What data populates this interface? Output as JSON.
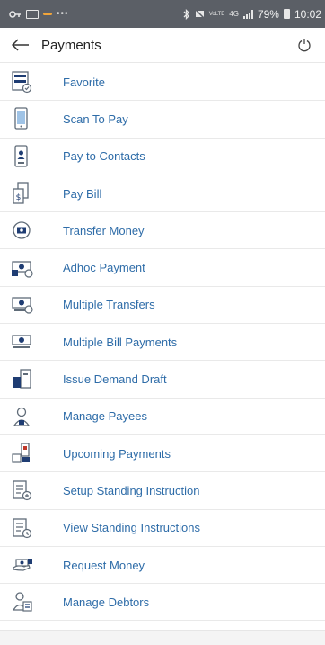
{
  "status_bar": {
    "battery_percent": "79%",
    "time": "10:02",
    "network": "4G",
    "volte_label": "VoLTE"
  },
  "header": {
    "title": "Payments"
  },
  "menu_items": [
    {
      "label": "Favorite",
      "icon": "favorite-card-icon"
    },
    {
      "label": "Scan To Pay",
      "icon": "scan-phone-icon"
    },
    {
      "label": "Pay to Contacts",
      "icon": "contact-phone-icon"
    },
    {
      "label": "Pay Bill",
      "icon": "bill-icon"
    },
    {
      "label": "Transfer Money",
      "icon": "transfer-money-icon"
    },
    {
      "label": "Adhoc Payment",
      "icon": "adhoc-payment-icon"
    },
    {
      "label": "Multiple Transfers",
      "icon": "multiple-transfers-icon"
    },
    {
      "label": "Multiple Bill Payments",
      "icon": "multiple-bills-icon"
    },
    {
      "label": "Issue Demand Draft",
      "icon": "demand-draft-icon"
    },
    {
      "label": "Manage Payees",
      "icon": "manage-payees-icon"
    },
    {
      "label": "Upcoming Payments",
      "icon": "upcoming-payments-icon"
    },
    {
      "label": "Setup Standing Instruction",
      "icon": "setup-instruction-icon"
    },
    {
      "label": "View Standing Instructions",
      "icon": "view-instructions-icon"
    },
    {
      "label": "Request Money",
      "icon": "request-money-icon"
    },
    {
      "label": "Manage Debtors",
      "icon": "manage-debtors-icon"
    }
  ],
  "colors": {
    "status_bar": "#5b5f66",
    "link_text": "#2e6ca8",
    "icon_dark": "#1f3d73",
    "icon_outline": "#5f6b78"
  }
}
